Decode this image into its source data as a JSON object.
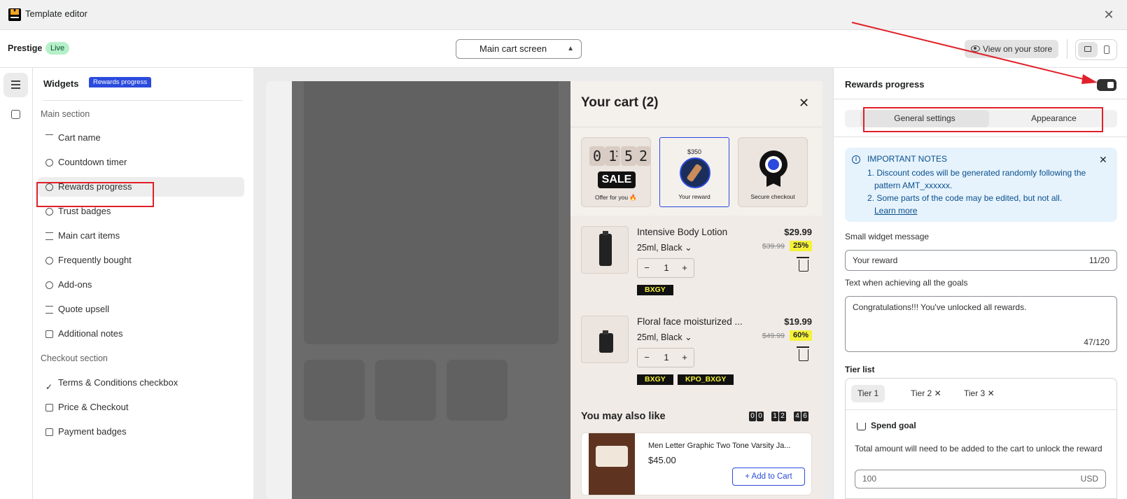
{
  "app": {
    "title": "Template editor"
  },
  "topbar": {
    "theme": "Prestige",
    "status": "Live",
    "screen": "Main cart screen",
    "view_store": "View on your store"
  },
  "widgets": {
    "title": "Widgets",
    "main_section": "Main section",
    "checkout_section": "Checkout section",
    "main_items": [
      "Cart name",
      "Countdown timer",
      "Rewards progress",
      "Trust badges",
      "Main cart items",
      "Frequently bought",
      "Add-ons",
      "Quote upsell",
      "Additional notes"
    ],
    "checkout_items": [
      "Terms & Conditions checkbox",
      "Price & Checkout",
      "Payment badges"
    ],
    "selected": "Rewards progress"
  },
  "cart": {
    "title": "Your cart (2)",
    "timer": [
      "0",
      "1",
      "5",
      "2"
    ],
    "timer_sep": ":",
    "sale": "SALE",
    "offer": "Offer for you 🔥",
    "rewards_tag": "Rewards progress",
    "reward_amount": "$350",
    "reward_label": "Your reward",
    "secure": "Secure checkout",
    "items": [
      {
        "name": "Intensive Body Lotion",
        "variant": "25ml, Black",
        "price": "$29.99",
        "old": "$39.99",
        "disc": "25%",
        "qty": "1",
        "tags": [
          "BXGY"
        ]
      },
      {
        "name": "Floral face moisturized ...",
        "variant": "25ml, Black",
        "price": "$19.99",
        "old": "$49.99",
        "disc": "60%",
        "qty": "1",
        "tags": [
          "BXGY",
          "KPO_BXGY"
        ]
      }
    ],
    "also_like": "You may also like",
    "also_timer": [
      "0",
      "0",
      "1",
      "2",
      "4",
      "6"
    ],
    "upsell": {
      "name": "Men Letter Graphic Two Tone Varsity Ja...",
      "price": "$45.00",
      "button": "+ Add to Cart"
    }
  },
  "panel": {
    "title": "Rewards progress",
    "tab_general": "General settings",
    "tab_appearance": "Appearance",
    "notes_title": "IMPORTANT NOTES",
    "note1": "1. Discount codes will be generated randomly following the pattern AMT_xxxxxx.",
    "note2": "2. Some parts of the code may be edited, but not all.",
    "learn_more": "Learn more",
    "small_msg_label": "Small widget message",
    "small_msg_value": "Your reward",
    "small_msg_count": "11/20",
    "achieve_label": "Text when achieving all the goals",
    "achieve_value": "Congratulations!!! You've unlocked all rewards.",
    "achieve_count": "47/120",
    "tier_label": "Tier list",
    "tiers": [
      "Tier 1",
      "Tier 2",
      "Tier 3"
    ],
    "spend_title": "Spend goal",
    "spend_desc": "Total amount will need to be added to the cart to unlock the reward",
    "spend_value": "100",
    "spend_unit": "USD"
  },
  "colors": {
    "accent": "#2b4bdd",
    "annotation": "#e0202a",
    "live_bg": "#b5f0c8"
  }
}
